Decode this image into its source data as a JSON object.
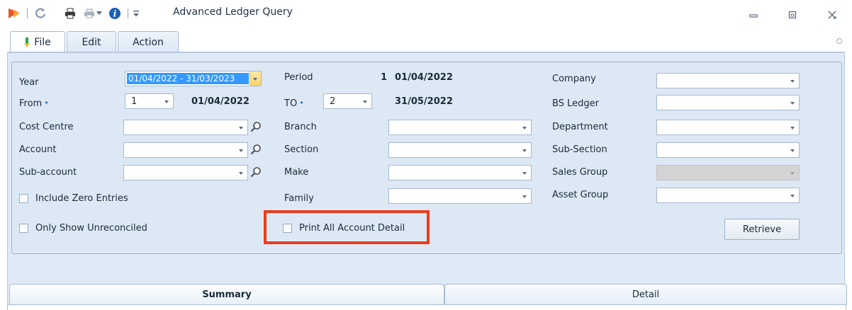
{
  "window": {
    "title": "Advanced Ledger Query",
    "controls": {
      "minimize": "▭",
      "maximize": "⧠",
      "close": "⤧"
    }
  },
  "ribbon": {
    "tabs": [
      {
        "label": "File"
      },
      {
        "label": "Edit"
      },
      {
        "label": "Action"
      }
    ]
  },
  "form": {
    "year": {
      "label": "Year",
      "value": "01/04/2022 - 31/03/2023"
    },
    "from": {
      "label": "From",
      "required_mark": "•",
      "value": "1",
      "date": "01/04/2022"
    },
    "period": {
      "label": "Period",
      "number": "1",
      "date": "01/04/2022"
    },
    "to": {
      "label": "TO",
      "required_mark": "•",
      "value": "2",
      "date": "31/05/2022"
    },
    "cost_centre": {
      "label": "Cost Centre",
      "value": ""
    },
    "account": {
      "label": "Account",
      "value": ""
    },
    "sub_account": {
      "label": "Sub-account",
      "value": ""
    },
    "branch": {
      "label": "Branch",
      "value": ""
    },
    "section": {
      "label": "Section",
      "value": ""
    },
    "make": {
      "label": "Make",
      "value": ""
    },
    "family": {
      "label": "Family",
      "value": ""
    },
    "company": {
      "label": "Company",
      "value": ""
    },
    "bs_ledger": {
      "label": "BS Ledger",
      "value": ""
    },
    "department": {
      "label": "Department",
      "value": ""
    },
    "sub_section": {
      "label": "Sub-Section",
      "value": ""
    },
    "sales_group": {
      "label": "Sales Group",
      "value": ""
    },
    "asset_group": {
      "label": "Asset Group",
      "value": ""
    },
    "include_zero_entries": {
      "label": "Include Zero Entries",
      "checked": false
    },
    "only_show_unreconciled": {
      "label": "Only Show Unreconciled",
      "checked": false
    },
    "print_all_account_detail": {
      "label": "Print All Account Detail",
      "checked": false
    },
    "retrieve_label": "Retrieve"
  },
  "bottom_tabs": [
    {
      "label": "Summary"
    },
    {
      "label": "Detail"
    }
  ],
  "colors": {
    "highlight": "#ea3c1c",
    "selection": "#3399ff",
    "panel": "#dde8f5"
  }
}
